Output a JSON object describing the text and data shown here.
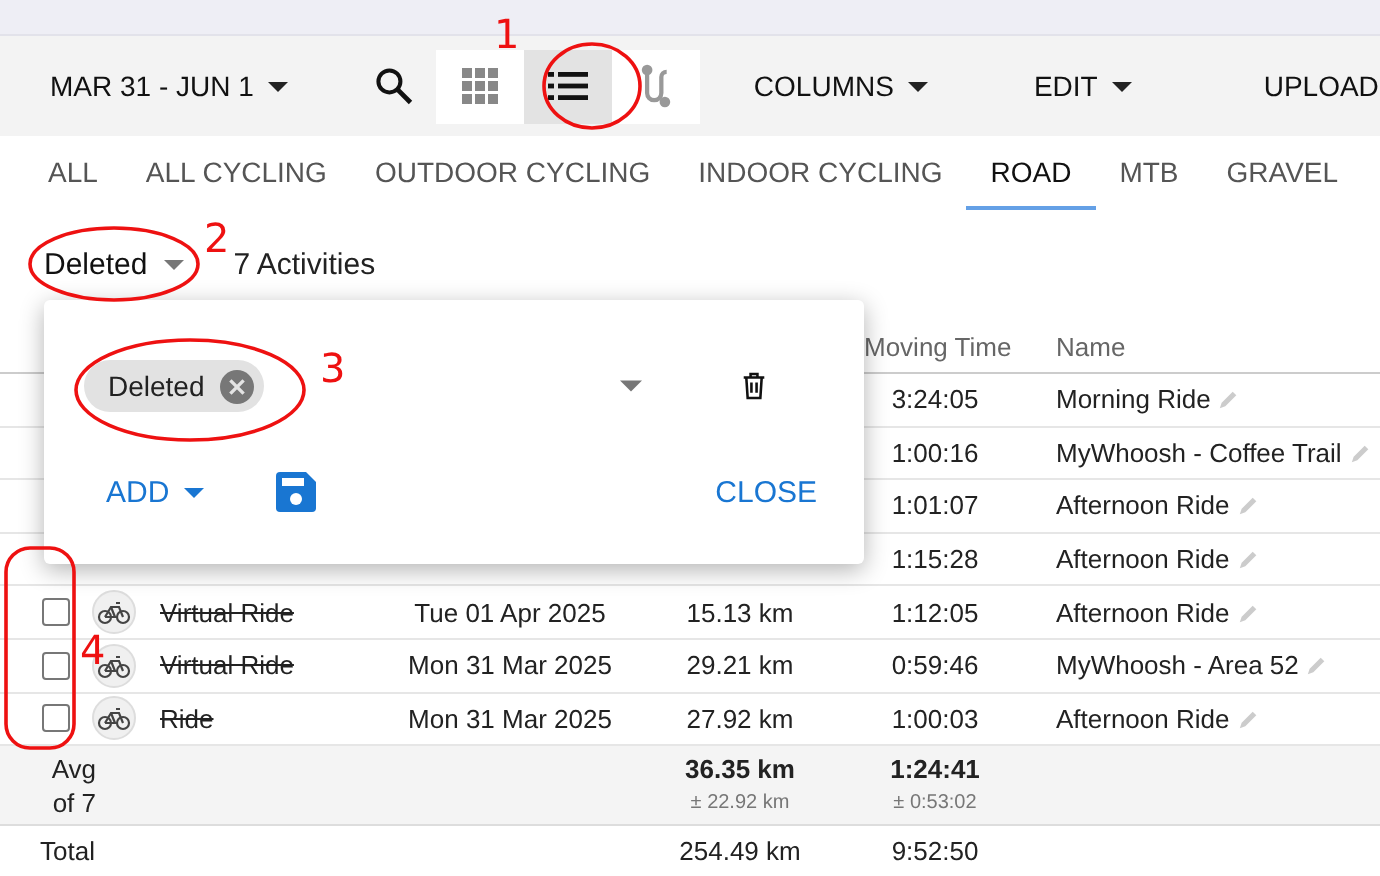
{
  "toolbar": {
    "date_range": "MAR 31 - JUN 1",
    "view_buttons": [
      {
        "kind": "grid",
        "selected": false
      },
      {
        "kind": "list",
        "selected": true
      },
      {
        "kind": "route",
        "selected": false
      }
    ],
    "menus": [
      "COLUMNS",
      "EDIT"
    ],
    "upload": "UPLOAD"
  },
  "tabs": [
    {
      "label": "ALL",
      "selected": false
    },
    {
      "label": "ALL CYCLING",
      "selected": false
    },
    {
      "label": "OUTDOOR CYCLING",
      "selected": false
    },
    {
      "label": "INDOOR CYCLING",
      "selected": false
    },
    {
      "label": "ROAD",
      "selected": true
    },
    {
      "label": "MTB",
      "selected": false
    },
    {
      "label": "GRAVEL",
      "selected": false
    }
  ],
  "filter": {
    "label": "Deleted",
    "count": "7 Activities"
  },
  "filter_popup": {
    "chips": [
      "Deleted"
    ],
    "add": "ADD",
    "close": "CLOSE"
  },
  "table": {
    "columns": [
      "Moving Time",
      "Name"
    ],
    "rows": [
      {
        "moving_time": "3:24:05",
        "name": "Morning Ride"
      },
      {
        "moving_time": "1:00:16",
        "name": "MyWhoosh - Coffee Trail"
      },
      {
        "moving_time": "1:01:07",
        "name": "Afternoon Ride"
      },
      {
        "moving_time": "1:15:28",
        "name": "Afternoon Ride"
      },
      {
        "checked": false,
        "type": "Virtual Ride",
        "deleted": true,
        "date": "Tue 01 Apr 2025",
        "distance": "15.13 km",
        "moving_time": "1:12:05",
        "name": "Afternoon Ride"
      },
      {
        "checked": false,
        "type": "Virtual Ride",
        "deleted": true,
        "date": "Mon 31 Mar 2025",
        "distance": "29.21 km",
        "moving_time": "0:59:46",
        "name": "MyWhoosh - Area 52"
      },
      {
        "checked": false,
        "type": "Ride",
        "deleted": true,
        "date": "Mon 31 Mar 2025",
        "distance": "27.92 km",
        "moving_time": "1:00:03",
        "name": "Afternoon Ride"
      }
    ],
    "average": {
      "label_1": "Avg",
      "label_2": "of 7",
      "distance": "36.35 km",
      "distance_dev": "± 22.92 km",
      "moving_time": "1:24:41",
      "moving_time_dev": "± 0:53:02"
    },
    "total": {
      "label": "Total",
      "distance": "254.49 km",
      "moving_time": "9:52:50"
    }
  },
  "annotations": [
    {
      "label": "1"
    },
    {
      "label": "2"
    },
    {
      "label": "3"
    },
    {
      "label": "4"
    }
  ]
}
